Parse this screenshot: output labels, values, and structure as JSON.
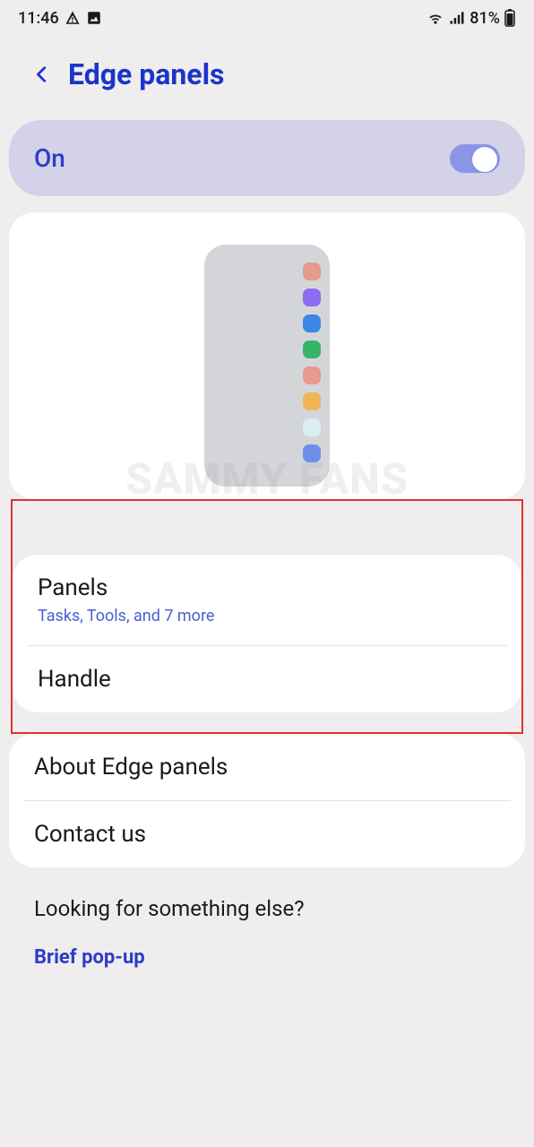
{
  "statusbar": {
    "time": "11:46",
    "battery": "81%"
  },
  "header": {
    "title": "Edge panels"
  },
  "toggle": {
    "label": "On"
  },
  "watermark": "SAMMY FANS",
  "panels_row": {
    "title": "Panels",
    "subtitle": "Tasks, Tools, and 7 more"
  },
  "handle_row": {
    "title": "Handle"
  },
  "about_row": {
    "title": "About Edge panels"
  },
  "contact_row": {
    "title": "Contact us"
  },
  "footer": {
    "title": "Looking for something else?",
    "link": "Brief pop-up"
  }
}
